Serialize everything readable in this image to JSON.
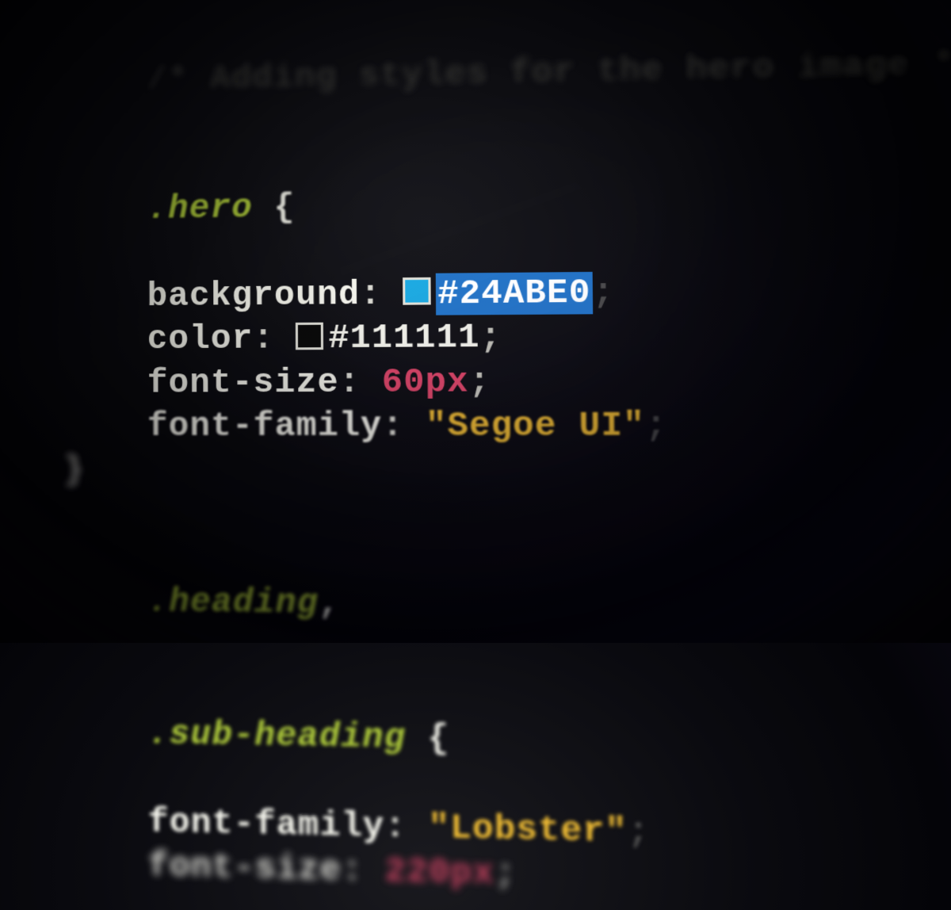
{
  "code": {
    "comment": "/* Adding styles for the hero image *",
    "rule1": {
      "selector": ".hero",
      "brace_open": " {",
      "brace_close": "}",
      "decl1": {
        "prop": "background",
        "swatch": "blue",
        "value": "#24ABE0",
        "selected": true
      },
      "decl2": {
        "prop": "color",
        "swatch": "dark",
        "value": "#111111"
      },
      "decl3": {
        "prop": "font-size",
        "num": "60",
        "unit": "px"
      },
      "decl4": {
        "prop": "font-family",
        "str": "Segoe UI"
      }
    },
    "rule2": {
      "selector1": ".heading",
      "comma": ",",
      "selector2": ".sub-heading",
      "brace_open": " {",
      "decl1": {
        "prop": "font-family",
        "str": "Lobster"
      },
      "decl2": {
        "prop": "font-size",
        "num": "220",
        "unit": "px"
      }
    }
  }
}
